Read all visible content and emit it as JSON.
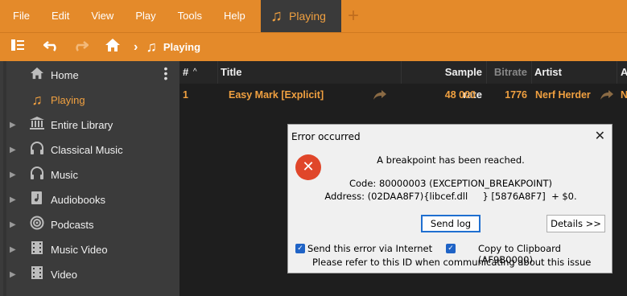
{
  "menubar": {
    "items": [
      "File",
      "Edit",
      "View",
      "Play",
      "Tools",
      "Help"
    ],
    "active_tab": "Playing",
    "add_tab_icon": "plus-icon"
  },
  "toolbar": {
    "breadcrumb": [
      "Playing"
    ]
  },
  "sidebar": {
    "items": [
      {
        "label": "Home",
        "icon": "home-icon",
        "expandable": false,
        "active": false
      },
      {
        "label": "Playing",
        "icon": "music-note-icon",
        "expandable": false,
        "active": true
      },
      {
        "label": "Entire Library",
        "icon": "library-icon",
        "expandable": true,
        "active": false
      },
      {
        "label": "Classical Music",
        "icon": "headphones-icon",
        "expandable": true,
        "active": false
      },
      {
        "label": "Music",
        "icon": "headphones-icon",
        "expandable": true,
        "active": false
      },
      {
        "label": "Audiobooks",
        "icon": "audiobook-icon",
        "expandable": true,
        "active": false
      },
      {
        "label": "Podcasts",
        "icon": "podcast-icon",
        "expandable": true,
        "active": false
      },
      {
        "label": "Music Video",
        "icon": "film-icon",
        "expandable": true,
        "active": false
      },
      {
        "label": "Video",
        "icon": "film-icon",
        "expandable": true,
        "active": false
      }
    ]
  },
  "tracklist": {
    "columns": {
      "number": "#",
      "sort_indicator": "^",
      "title": "Title",
      "sample_rate": "Sample rate",
      "bitrate": "Bitrate",
      "artist": "Artist",
      "overflow": "A"
    },
    "rows": [
      {
        "number": "1",
        "title": "Easy Mark [Explicit]",
        "sample_rate": "48 000",
        "bitrate": "1776",
        "artist": "Nerf Herder",
        "overflow": "N"
      }
    ]
  },
  "dialog": {
    "title": "Error occurred",
    "message": "A breakpoint has been reached.",
    "code_line": "Code: 80000003 (EXCEPTION_BREAKPOINT)",
    "address_line": "Address: (02DAA8F7){libcef.dll     } [5876A8F7]  + $0.",
    "send_log_label": "Send log",
    "details_label": "Details >>",
    "send_error_label": "Send this error via Internet",
    "send_error_checked": true,
    "copy_label": "Copy to Clipboard (AF9B0000)",
    "copy_checked": true,
    "note": "Please refer to this ID when communicating about this issue"
  },
  "colors": {
    "accent": "#e48a2a",
    "active_text": "#f0a040",
    "sidebar_bg": "#3b3b3b",
    "content_bg": "#1e1e1e",
    "error_red": "#e0462a"
  }
}
